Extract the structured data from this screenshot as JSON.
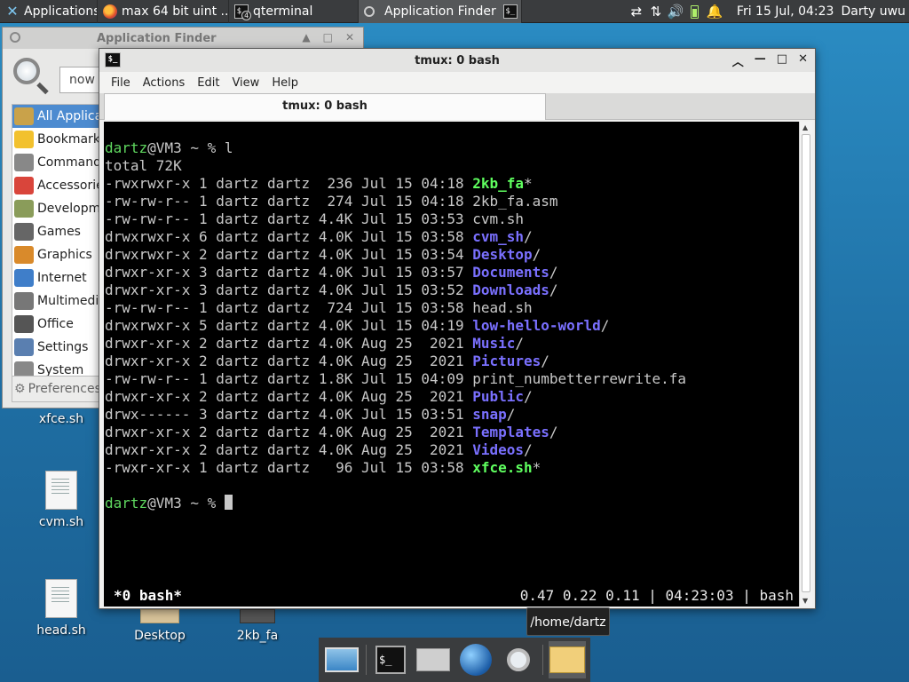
{
  "top_panel": {
    "applications_label": "Applications",
    "tasks": [
      {
        "label": "max 64 bit uint ...",
        "icon": "firefox-icon"
      },
      {
        "label": "qterminal",
        "icon": "terminal-icon",
        "badge": "4"
      },
      {
        "label": "Application Finder",
        "icon": "search-icon"
      }
    ],
    "clock": "Fri 15 Jul, 04:23",
    "user": "Darty uwu"
  },
  "desktop": {
    "icons": [
      {
        "label": "xfce.sh"
      },
      {
        "label": "cvm.sh"
      },
      {
        "label": "head.sh"
      },
      {
        "label": "Desktop"
      },
      {
        "label": "2kb_fa"
      }
    ]
  },
  "appfinder": {
    "title": "Application Finder",
    "search_value": "now r",
    "categories": [
      {
        "label": "All Applications",
        "color": "#c9a24a"
      },
      {
        "label": "Bookmarks",
        "color": "#f2c12e"
      },
      {
        "label": "Commands",
        "color": "#888888"
      },
      {
        "label": "Accessories",
        "color": "#d9453b"
      },
      {
        "label": "Development",
        "color": "#8a9c5a"
      },
      {
        "label": "Games",
        "color": "#666666"
      },
      {
        "label": "Graphics",
        "color": "#d98a2b"
      },
      {
        "label": "Internet",
        "color": "#3f7ec9"
      },
      {
        "label": "Multimedia",
        "color": "#777777"
      },
      {
        "label": "Office",
        "color": "#555555"
      },
      {
        "label": "Settings",
        "color": "#5a7fb0"
      },
      {
        "label": "System",
        "color": "#888888"
      }
    ],
    "preferences_label": "Preferences"
  },
  "terminal": {
    "title": "tmux: 0 bash",
    "menu": [
      "File",
      "Actions",
      "Edit",
      "View",
      "Help"
    ],
    "tab_label": "tmux: 0 bash",
    "prompt_user": "dartz",
    "prompt_rest": "@VM3 ~ % ",
    "command": "l",
    "total": "total 72K",
    "listing": [
      {
        "meta": "-rwxrwxr-x 1 dartz dartz  236 Jul 15 04:18 ",
        "name": "2kb_fa",
        "suffix": "*",
        "kind": "exec"
      },
      {
        "meta": "-rw-rw-r-- 1 dartz dartz  274 Jul 15 04:18 ",
        "name": "2kb_fa.asm",
        "suffix": "",
        "kind": "file"
      },
      {
        "meta": "-rw-rw-r-- 1 dartz dartz 4.4K Jul 15 03:53 ",
        "name": "cvm.sh",
        "suffix": "",
        "kind": "file"
      },
      {
        "meta": "drwxrwxr-x 6 dartz dartz 4.0K Jul 15 03:58 ",
        "name": "cvm_sh",
        "suffix": "/",
        "kind": "dir"
      },
      {
        "meta": "drwxrwxr-x 2 dartz dartz 4.0K Jul 15 03:54 ",
        "name": "Desktop",
        "suffix": "/",
        "kind": "dir"
      },
      {
        "meta": "drwxr-xr-x 3 dartz dartz 4.0K Jul 15 03:57 ",
        "name": "Documents",
        "suffix": "/",
        "kind": "dir"
      },
      {
        "meta": "drwxr-xr-x 3 dartz dartz 4.0K Jul 15 03:52 ",
        "name": "Downloads",
        "suffix": "/",
        "kind": "dir"
      },
      {
        "meta": "-rw-rw-r-- 1 dartz dartz  724 Jul 15 03:58 ",
        "name": "head.sh",
        "suffix": "",
        "kind": "file"
      },
      {
        "meta": "drwxrwxr-x 5 dartz dartz 4.0K Jul 15 04:19 ",
        "name": "low-hello-world",
        "suffix": "/",
        "kind": "dir"
      },
      {
        "meta": "drwxr-xr-x 2 dartz dartz 4.0K Aug 25  2021 ",
        "name": "Music",
        "suffix": "/",
        "kind": "dir"
      },
      {
        "meta": "drwxr-xr-x 2 dartz dartz 4.0K Aug 25  2021 ",
        "name": "Pictures",
        "suffix": "/",
        "kind": "dir"
      },
      {
        "meta": "-rw-rw-r-- 1 dartz dartz 1.8K Jul 15 04:09 ",
        "name": "print_numbetterrewrite.fa",
        "suffix": "",
        "kind": "file"
      },
      {
        "meta": "drwxr-xr-x 2 dartz dartz 4.0K Aug 25  2021 ",
        "name": "Public",
        "suffix": "/",
        "kind": "dir"
      },
      {
        "meta": "drwx------ 3 dartz dartz 4.0K Jul 15 03:51 ",
        "name": "snap",
        "suffix": "/",
        "kind": "dir"
      },
      {
        "meta": "drwxr-xr-x 2 dartz dartz 4.0K Aug 25  2021 ",
        "name": "Templates",
        "suffix": "/",
        "kind": "dir"
      },
      {
        "meta": "drwxr-xr-x 2 dartz dartz 4.0K Aug 25  2021 ",
        "name": "Videos",
        "suffix": "/",
        "kind": "dir"
      },
      {
        "meta": "-rwxr-xr-x 1 dartz dartz   96 Jul 15 03:58 ",
        "name": "xfce.sh",
        "suffix": "*",
        "kind": "exec"
      }
    ],
    "status_left": "*0 bash*",
    "status_right": "0.47 0.22 0.11 | 04:23:03 | bash"
  },
  "tooltip": "/home/dartz",
  "dock": {
    "items": [
      {
        "icon": "show-desktop-icon"
      },
      {
        "icon": "terminal-icon",
        "glyph": "$_"
      },
      {
        "icon": "home-folder-icon"
      },
      {
        "icon": "web-browser-icon"
      },
      {
        "icon": "app-finder-icon"
      },
      {
        "icon": "folder-icon"
      }
    ]
  },
  "colors": {
    "prompt_green": "#5fd75f",
    "dir_blue": "#7a70ff",
    "exec_green": "#5fff5f"
  }
}
